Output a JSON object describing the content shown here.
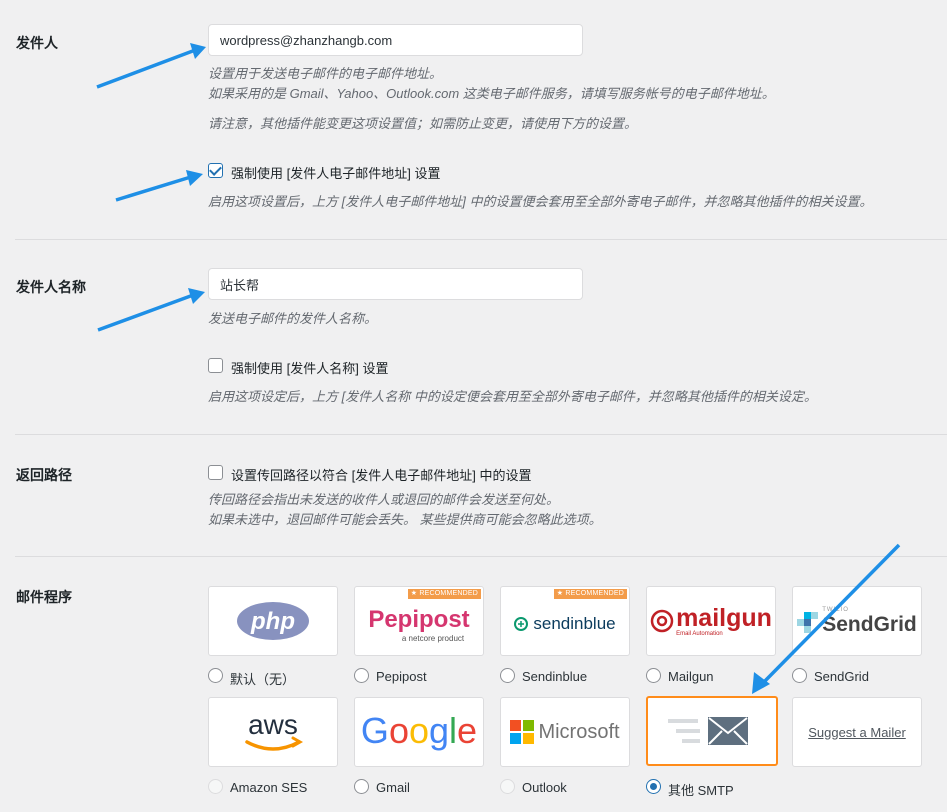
{
  "from_email": {
    "label": "发件人",
    "value": "wordpress@zhanzhangb.com",
    "desc1": "设置用于发送电子邮件的电子邮件地址。",
    "desc2": "如果采用的是 Gmail、Yahoo、Outlook.com 这类电子邮件服务，请填写服务帐号的电子邮件地址。",
    "desc3": "请注意，其他插件能变更这项设置值；如需防止变更，请使用下方的设置。",
    "force_label": "强制使用 [发件人电子邮件地址] 设置",
    "force_checked": true,
    "force_desc": "启用这项设置后，上方 [发件人电子邮件地址] 中的设置便会套用至全部外寄电子邮件，并忽略其他插件的相关设置。"
  },
  "from_name": {
    "label": "发件人名称",
    "value": "站长帮",
    "desc": "发送电子邮件的发件人名称。",
    "force_label": "强制使用 [发件人名称] 设置",
    "force_checked": false,
    "force_desc": "启用这项设定后，上方 [发件人名称 中的设定便会套用至全部外寄电子邮件，并忽略其他插件的相关设定。"
  },
  "return_path": {
    "label": "返回路径",
    "check_label": "设置传回路径以符合 [发件人电子邮件地址] 中的设置",
    "checked": false,
    "desc1": "传回路径会指出未发送的收件人或退回的邮件会发送至何处。",
    "desc2": "如果未选中，退回邮件可能会丢失。 某些提供商可能会忽略此选项。"
  },
  "mailer": {
    "label": "邮件程序",
    "recommended": "RECOMMENDED",
    "options": [
      {
        "label": "默认（无）",
        "logo_text": "php",
        "checked": false,
        "disabled": false
      },
      {
        "label": "Pepipost",
        "logo_text": "Pepipost",
        "logo_sub": "a netcore product",
        "checked": false,
        "disabled": false
      },
      {
        "label": "Sendinblue",
        "logo_text": "sendinblue",
        "checked": false,
        "disabled": false
      },
      {
        "label": "Mailgun",
        "logo_text": "mailgun",
        "logo_sub": "Email Automation",
        "checked": false,
        "disabled": false
      },
      {
        "label": "SendGrid",
        "logo_text": "SendGrid",
        "logo_sub": "TWILIO",
        "checked": false,
        "disabled": false
      },
      {
        "label": "Amazon SES",
        "logo_text": "aws",
        "checked": false,
        "disabled": true
      },
      {
        "label": "Gmail",
        "logo_text": "Google",
        "checked": false,
        "disabled": false
      },
      {
        "label": "Outlook",
        "logo_text": "Microsoft",
        "checked": false,
        "disabled": true
      },
      {
        "label": "其他 SMTP",
        "logo_text": "",
        "checked": true,
        "disabled": false
      }
    ],
    "suggest": "Suggest a Mailer"
  },
  "colors": {
    "accent": "#2271b1",
    "arrow": "#1e8fe6",
    "selected_border": "#ff8c1a",
    "badge": "#f39c4a"
  }
}
